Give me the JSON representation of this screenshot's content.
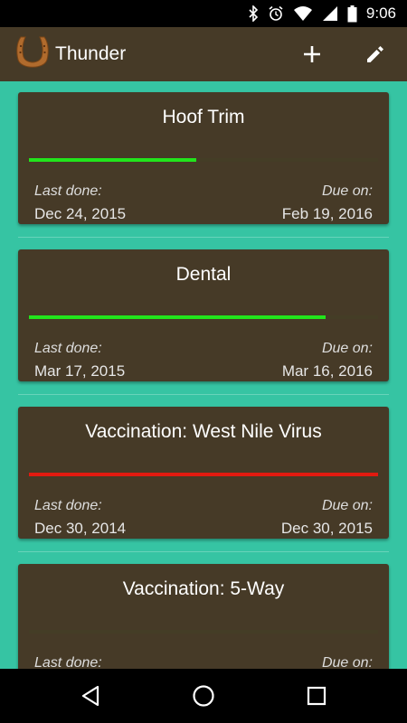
{
  "status": {
    "time": "9:06"
  },
  "appbar": {
    "title": "Thunder",
    "add_icon": "plus-icon",
    "edit_icon": "pencil-icon",
    "logo_icon": "horseshoe-icon"
  },
  "colors": {
    "appbar": "#463a27",
    "content_bg": "#36c4a3",
    "good": "#22e41c",
    "overdue": "#e11a10",
    "track": "#443d26"
  },
  "cards": [
    {
      "title": "Hoof Trim",
      "progress": 0.48,
      "status": "good",
      "last_label": "Last done:",
      "last_value": "Dec 24, 2015",
      "due_label": "Due on:",
      "due_value": "Feb 19, 2016"
    },
    {
      "title": "Dental",
      "progress": 0.85,
      "status": "good",
      "last_label": "Last done:",
      "last_value": "Mar 17, 2015",
      "due_label": "Due on:",
      "due_value": "Mar 16, 2016"
    },
    {
      "title": "Vaccination: West Nile Virus",
      "progress": 1.0,
      "status": "overdue",
      "last_label": "Last done:",
      "last_value": "Dec 30, 2014",
      "due_label": "Due on:",
      "due_value": "Dec 30, 2015"
    },
    {
      "title": "Vaccination: 5-Way",
      "progress": 0.0,
      "status": "good",
      "last_label": "Last done:",
      "last_value": "",
      "due_label": "Due on:",
      "due_value": ""
    }
  ],
  "navbar": {
    "back_icon": "back-triangle-icon",
    "home_icon": "home-circle-icon",
    "recents_icon": "recents-square-icon"
  }
}
